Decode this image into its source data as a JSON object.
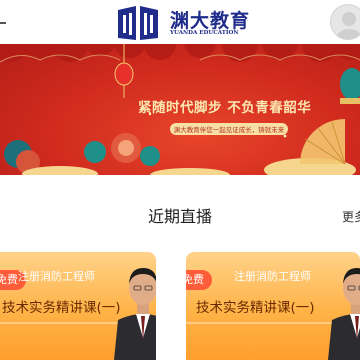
{
  "header": {
    "menu_icon": "hamburger-menu-icon",
    "logo_text": "渊大教育",
    "logo_subtext": "YUANDA EDUCATION",
    "logo_icon": "book-icon",
    "avatar_icon": "user-avatar-icon",
    "brand_color": "#1f2c8c"
  },
  "banner": {
    "slogan": "紧随时代脚步   不负青春韶华",
    "pill_text": "渊大教育伴您一起见证成长，铸就未来"
  },
  "section": {
    "title": "近期直播",
    "more_label": "更多"
  },
  "cards": [
    {
      "badge": "免费",
      "subtitle": "注册消防工程师",
      "title": "技术实务精讲课(一)"
    },
    {
      "badge": "免费",
      "subtitle": "注册消防工程师",
      "title": "技术实务精讲课(一)"
    }
  ],
  "colors": {
    "banner_red": "#cf2a1d",
    "gold": "#fce7b0",
    "card_orange": "#ffb347",
    "badge_red": "#ff5c39"
  }
}
